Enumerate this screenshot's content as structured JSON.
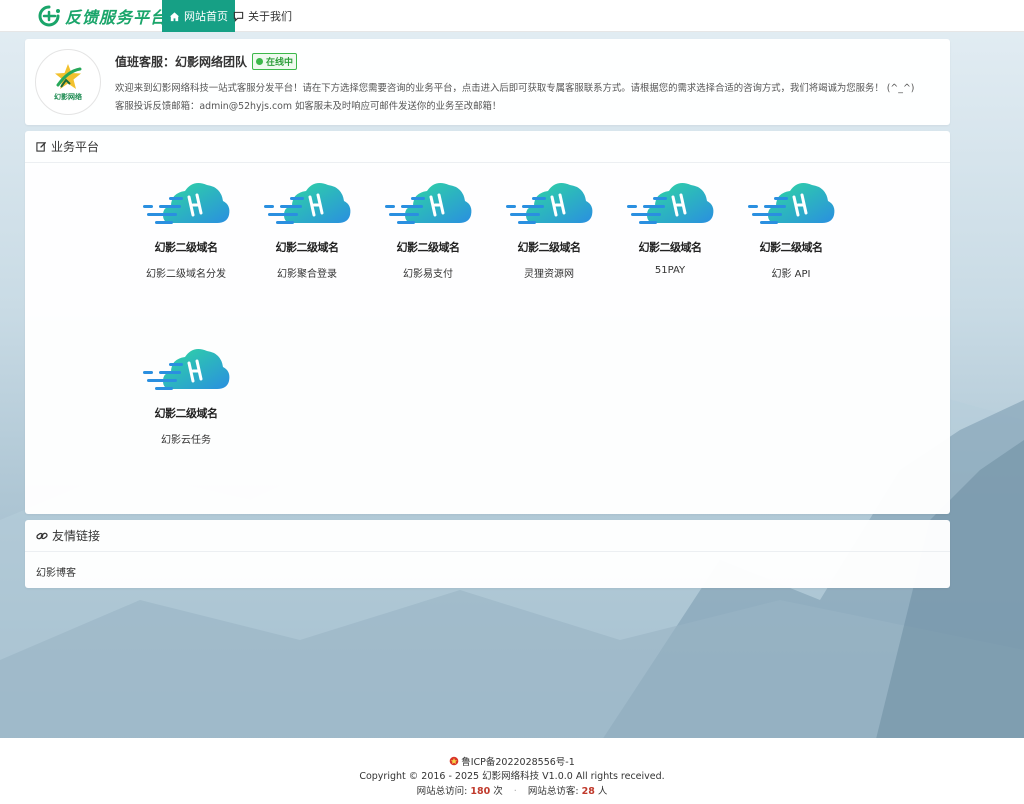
{
  "brand": {
    "name": "反馈服务平台"
  },
  "nav": [
    {
      "label": "网站首页",
      "icon": "home-icon",
      "active": true
    },
    {
      "label": "关于我们",
      "icon": "chat-icon",
      "active": false
    }
  ],
  "profile": {
    "avatar_text": "幻影网络",
    "title": "值班客服：幻影网络团队",
    "status": "在线中",
    "welcome": "欢迎来到幻影网络科技一站式客服分发平台！请在下方选择您需要咨询的业务平台，点击进入后即可获取专属客服联系方式。请根据您的需求选择合适的咨询方式，我们将竭诚为您服务！ (^_^)",
    "email_line": "客服投诉反馈邮箱：admin@52hyjs.com 如客服未及时响应可邮件发送你的业务至改邮箱！"
  },
  "platforms_section": {
    "title": "业务平台",
    "logo_text": "幻影二级域名",
    "items": [
      {
        "label": "幻影二级域名分发"
      },
      {
        "label": "幻影聚合登录"
      },
      {
        "label": "幻影易支付"
      },
      {
        "label": "灵狸资源网"
      },
      {
        "label": "51PAY"
      },
      {
        "label": "幻影 API"
      },
      {
        "label": "幻影云任务"
      }
    ]
  },
  "links_section": {
    "title": "友情链接",
    "links": [
      {
        "label": "幻影博客"
      }
    ]
  },
  "footer": {
    "icp": "鲁ICP备2022028556号-1",
    "copyright": "Copyright © 2016 - 2025 幻影网络科技 V1.0.0 All rights received.",
    "visits_label": "网站总访问:",
    "visits_value": "180",
    "visits_unit": "次",
    "visitors_label": "网站总访客:",
    "visitors_value": "28",
    "visitors_unit": "人"
  },
  "colors": {
    "accent": "#16a085",
    "brand": "#1aa56a",
    "status": "#3cb84a"
  }
}
